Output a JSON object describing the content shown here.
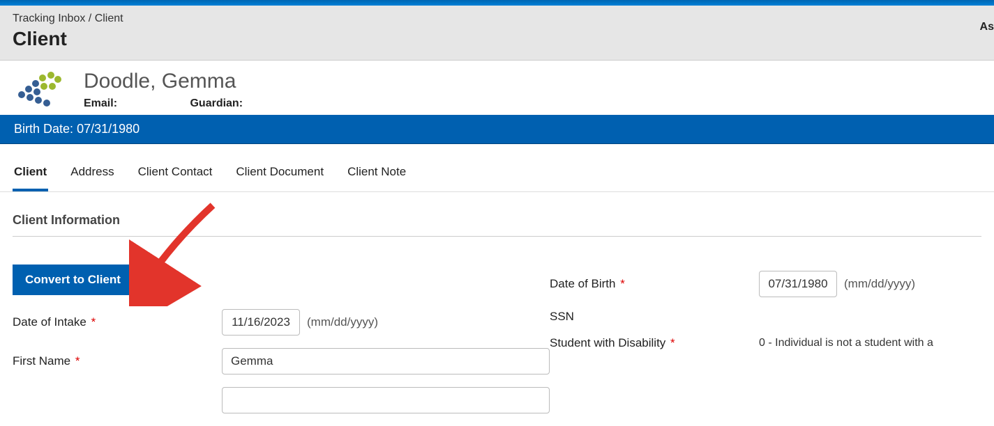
{
  "breadcrumb": {
    "parent": "Tracking Inbox",
    "current": "Client"
  },
  "page_title": "Client",
  "header_right": "As",
  "profile": {
    "name": "Doodle, Gemma",
    "email_label": "Email:",
    "email_value": "",
    "guardian_label": "Guardian:",
    "guardian_value": ""
  },
  "info_strip": {
    "label": "Birth Date:",
    "value": "07/31/1980"
  },
  "tabs": [
    "Client",
    "Address",
    "Client Contact",
    "Client Document",
    "Client Note"
  ],
  "section_title": "Client Information",
  "convert_button": "Convert to Client",
  "fields": {
    "date_of_intake": {
      "label": "Date of Intake",
      "value": "11/16/2023",
      "hint": "(mm/dd/yyyy)"
    },
    "first_name": {
      "label": "First Name",
      "value": "Gemma"
    },
    "date_of_birth": {
      "label": "Date of Birth",
      "value": "07/31/1980",
      "hint": "(mm/dd/yyyy)"
    },
    "ssn": {
      "label": "SSN",
      "value": ""
    },
    "student_disability": {
      "label": "Student with Disability",
      "value": "0 - Individual is not a student with a "
    }
  }
}
